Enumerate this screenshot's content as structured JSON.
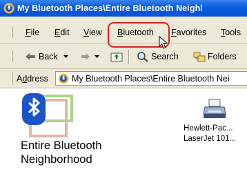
{
  "window": {
    "title": "My Bluetooth Places\\Entire Bluetooth Neighl"
  },
  "menubar": {
    "items": [
      {
        "mnemonic": "F",
        "rest": "ile"
      },
      {
        "mnemonic": "E",
        "rest": "dit"
      },
      {
        "mnemonic": "V",
        "rest": "iew"
      },
      {
        "mnemonic": "B",
        "rest": "luetooth"
      },
      {
        "mnemonic": "F",
        "rest": "avorites"
      },
      {
        "mnemonic": "T",
        "rest": "ools"
      }
    ]
  },
  "toolbar": {
    "back_label": "Back",
    "search_label": "Search",
    "folders_label": "Folders"
  },
  "addressbar": {
    "label_mnemonic": "d",
    "label_pre": "A",
    "label_post": "dress",
    "value": "My Bluetooth Places\\Entire Bluetooth Nei"
  },
  "content": {
    "hero_title_line1": "Entire Bluetooth",
    "hero_title_line2": "Neighborhood",
    "devices": [
      {
        "name_line1": "Hewlett-Pac...",
        "name_line2": "LaserJet 101...",
        "icon": "printer-icon"
      }
    ]
  },
  "colors": {
    "titlebar": "#0a5ee0",
    "chrome": "#ece9d8",
    "highlight_ring": "#d9201f",
    "bluetooth_blue": "#1a55c8"
  }
}
